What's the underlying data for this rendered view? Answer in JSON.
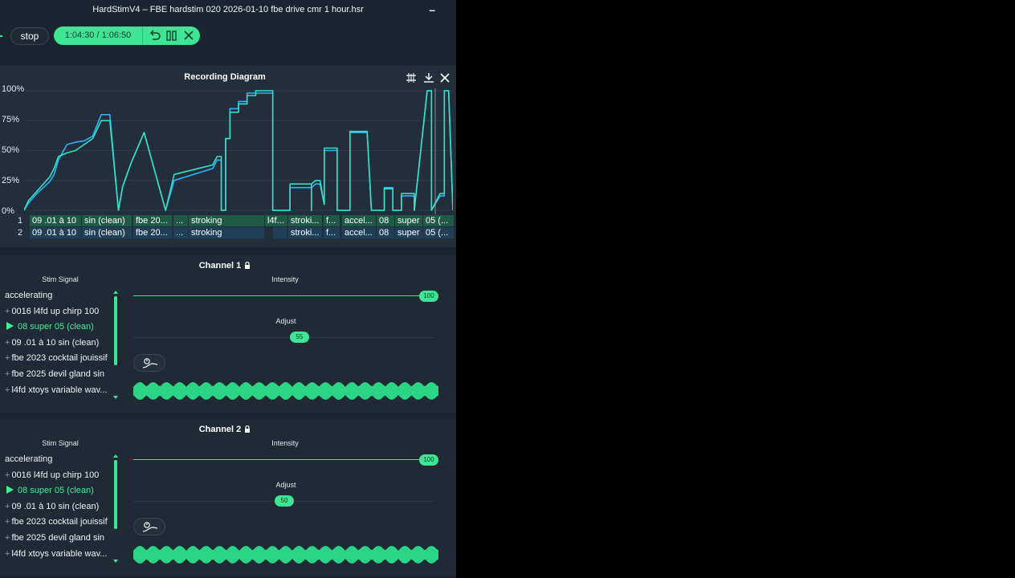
{
  "window": {
    "title": "HardStimV4 – FBE hardstim 020 2026-01-10 fbe drive cmr 1 hour.hsr",
    "minimize_glyph": "–"
  },
  "toolbar": {
    "stop_label": "stop",
    "time_display": "1:04:30 / 1:06:50",
    "icons": [
      "undo-icon",
      "pause-icon",
      "close-icon"
    ]
  },
  "diagram": {
    "title": "Recording Diagram",
    "icons": [
      "fit-icon",
      "download-icon",
      "close-icon"
    ],
    "y_ticks": [
      "100%",
      "75%",
      "50%",
      "25%",
      "0%"
    ],
    "tracks": [
      {
        "number": "1",
        "segments": [
          "09 .01 à 10",
          "sin (clean)",
          "fbe 20...",
          "...",
          "stroking",
          "l4f...",
          "stroki...",
          "f...",
          "accel...",
          "08",
          "super",
          "05 (..."
        ]
      },
      {
        "number": "2",
        "segments": [
          "09 .01 à 10",
          "sin (clean)",
          "fbe 20...",
          "...",
          "stroking",
          "",
          "stroki...",
          "f...",
          "accel...",
          "08",
          "super",
          "05 (..."
        ]
      }
    ]
  },
  "chart_data": {
    "type": "line",
    "title": "Recording Diagram",
    "xlabel": "",
    "ylabel": "",
    "ylim": [
      0,
      100
    ],
    "y_unit": "%",
    "x_unit": "fraction of recording",
    "grid": true,
    "series": [
      {
        "color": "#2db3ff",
        "x": [
          0,
          0.01,
          0.03,
          0.06,
          0.07,
          0.08,
          0.1,
          0.12,
          0.14,
          0.16,
          0.18,
          0.2,
          0.22,
          0.22,
          0.23,
          0.25,
          0.25,
          0.28,
          0.28,
          0.33,
          0.33,
          0.35,
          0.44,
          0.45,
          0.46,
          0.46,
          0.47,
          0.47,
          0.48,
          0.48,
          0.5,
          0.5,
          0.52,
          0.52,
          0.54,
          0.54,
          0.58,
          0.58,
          0.62,
          0.62,
          0.67,
          0.67,
          0.67,
          0.68,
          0.69,
          0.7,
          0.7,
          0.7,
          0.7,
          0.73,
          0.73,
          0.76,
          0.76,
          0.8,
          0.81,
          0.82,
          0.84,
          0.84,
          0.86,
          0.86,
          0.88,
          0.88,
          0.91,
          0.91,
          0.94,
          0.95,
          0.95,
          0.97,
          0.98,
          0.98,
          0.99,
          0.99,
          1.0
        ],
        "y": [
          0,
          6,
          14,
          24,
          30,
          42,
          55,
          57,
          58,
          62,
          80,
          80,
          0,
          0,
          20,
          40,
          40,
          65,
          65,
          0,
          0,
          25,
          35,
          42,
          42,
          0,
          0,
          60,
          60,
          85,
          85,
          91,
          91,
          98,
          98,
          98,
          98,
          0,
          0,
          19,
          19,
          0,
          19,
          22,
          22,
          5,
          22,
          22,
          50,
          50,
          0,
          0,
          65,
          65,
          0,
          0,
          0,
          19,
          19,
          0,
          0,
          12,
          12,
          0,
          100,
          100,
          0,
          12,
          12,
          100,
          100,
          100,
          0
        ]
      },
      {
        "color": "#34e1c4",
        "x": [
          0,
          0.01,
          0.03,
          0.06,
          0.07,
          0.08,
          0.1,
          0.12,
          0.14,
          0.16,
          0.18,
          0.2,
          0.22,
          0.22,
          0.23,
          0.25,
          0.25,
          0.28,
          0.28,
          0.33,
          0.33,
          0.35,
          0.44,
          0.45,
          0.46,
          0.46,
          0.47,
          0.47,
          0.48,
          0.48,
          0.5,
          0.5,
          0.52,
          0.52,
          0.54,
          0.54,
          0.58,
          0.58,
          0.62,
          0.62,
          0.67,
          0.67,
          0.67,
          0.68,
          0.69,
          0.7,
          0.7,
          0.7,
          0.7,
          0.73,
          0.73,
          0.76,
          0.76,
          0.8,
          0.81,
          0.82,
          0.84,
          0.84,
          0.86,
          0.86,
          0.88,
          0.88,
          0.91,
          0.91,
          0.94,
          0.95,
          0.95,
          0.97,
          0.98,
          0.98,
          0.99,
          0.99,
          1.0
        ],
        "y": [
          0,
          8,
          16,
          28,
          35,
          45,
          48,
          50,
          55,
          60,
          75,
          75,
          0,
          0,
          20,
          40,
          40,
          65,
          65,
          0,
          0,
          30,
          38,
          45,
          45,
          0,
          0,
          60,
          60,
          82,
          82,
          89,
          89,
          96,
          96,
          100,
          100,
          0,
          0,
          22,
          22,
          0,
          22,
          25,
          25,
          5,
          25,
          25,
          52,
          52,
          0,
          0,
          66,
          66,
          0,
          0,
          0,
          18,
          18,
          0,
          0,
          14,
          14,
          0,
          100,
          100,
          0,
          14,
          14,
          100,
          100,
          100,
          0
        ]
      }
    ]
  },
  "channels": [
    {
      "title": "Channel 1",
      "lock_icon": "lock-icon",
      "stim_signal_header": "Stim Signal",
      "intensity_header": "Intensity",
      "intensity_value": "100",
      "intensity_level": 1.0,
      "adjust_header": "Adjust",
      "adjust_value": "55",
      "adjust_level": 0.55,
      "signals": [
        {
          "label": "accelerating",
          "prefix": "",
          "active": false
        },
        {
          "label": "0016 l4fd up chirp 100",
          "prefix": "+",
          "active": false
        },
        {
          "label": "08 super 05 (clean)",
          "prefix": "",
          "active": true
        },
        {
          "label": "09 .01 à 10 sin (clean)",
          "prefix": "+",
          "active": false
        },
        {
          "label": "fbe 2023 cocktail jouissif",
          "prefix": "+",
          "active": false
        },
        {
          "label": "fbe 2025 devil gland sin",
          "prefix": "+",
          "active": false
        },
        {
          "label": "l4fd xtoys variable wav...",
          "prefix": "+",
          "active": false
        }
      ]
    },
    {
      "title": "Channel 2",
      "lock_icon": "lock-icon",
      "stim_signal_header": "Stim Signal",
      "intensity_header": "Intensity",
      "intensity_value": "100",
      "intensity_level": 1.0,
      "adjust_header": "Adjust",
      "adjust_value": "50",
      "adjust_level": 0.5,
      "signals": [
        {
          "label": "accelerating",
          "prefix": "",
          "active": false
        },
        {
          "label": "0016 l4fd up chirp 100",
          "prefix": "+",
          "active": false
        },
        {
          "label": "08 super 05 (clean)",
          "prefix": "",
          "active": true
        },
        {
          "label": "09 .01 à 10 sin (clean)",
          "prefix": "+",
          "active": false
        },
        {
          "label": "fbe 2023 cocktail jouissif",
          "prefix": "+",
          "active": false
        },
        {
          "label": "fbe 2025 devil gland sin",
          "prefix": "+",
          "active": false
        },
        {
          "label": "l4fd xtoys variable wav...",
          "prefix": "+",
          "active": false
        }
      ]
    }
  ],
  "colors": {
    "accent": "#3ee594",
    "series_blue": "#2db3ff",
    "series_teal": "#34e1c4",
    "panel": "#222e39",
    "background": "#1b252f"
  }
}
